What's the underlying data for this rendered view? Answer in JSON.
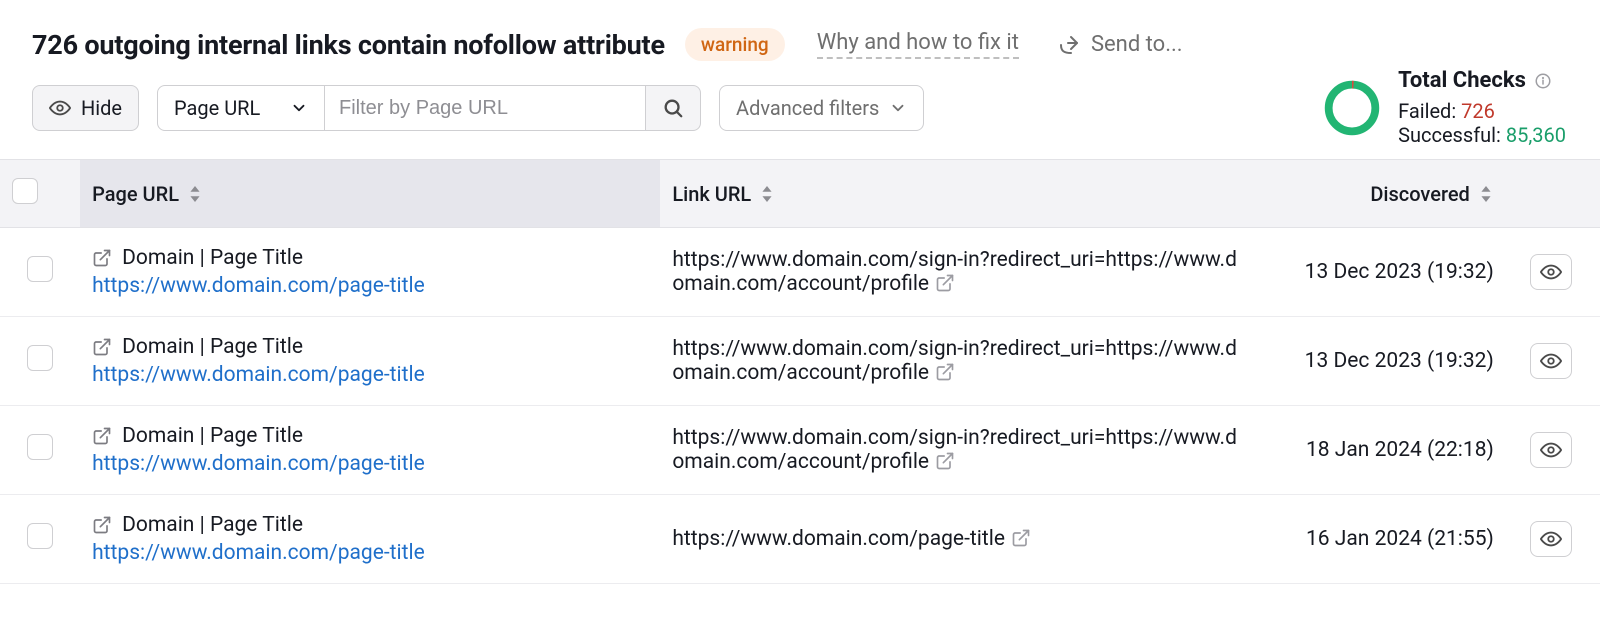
{
  "header": {
    "title": "726 outgoing internal links contain nofollow attribute",
    "badge": "warning",
    "fix_link": "Why and how to fix it",
    "send_to": "Send to..."
  },
  "controls": {
    "hide": "Hide",
    "filter_field": "Page URL",
    "filter_placeholder": "Filter by Page URL",
    "advanced": "Advanced filters"
  },
  "checks": {
    "title": "Total Checks",
    "failed_label": "Failed:",
    "failed_value": "726",
    "successful_label": "Successful:",
    "successful_value": "85,360"
  },
  "columns": {
    "page": "Page URL",
    "link": "Link URL",
    "discovered": "Discovered"
  },
  "rows": [
    {
      "page_title": "Domain | Page Title",
      "page_url": "https://www.domain.com/page-title",
      "link_url": "https://www.domain.com/sign-in?redirect_uri=https://www.domain.com/account/profile",
      "discovered": "13 Dec 2023 (19:32)"
    },
    {
      "page_title": "Domain | Page Title",
      "page_url": "https://www.domain.com/page-title",
      "link_url": "https://www.domain.com/sign-in?redirect_uri=https://www.domain.com/account/profile",
      "discovered": "13 Dec 2023 (19:32)"
    },
    {
      "page_title": "Domain | Page Title",
      "page_url": "https://www.domain.com/page-title",
      "link_url": "https://www.domain.com/sign-in?redirect_uri=https://www.domain.com/account/profile",
      "discovered": "18 Jan 2024 (22:18)"
    },
    {
      "page_title": "Domain | Page Title",
      "page_url": "https://www.domain.com/page-title",
      "link_url": "https://www.domain.com/page-title",
      "discovered": "16 Jan 2024 (21:55)"
    }
  ]
}
